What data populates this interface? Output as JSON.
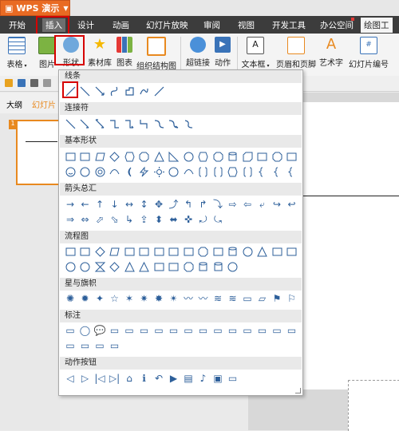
{
  "app": {
    "title": "WPS 演示"
  },
  "menu": {
    "tabs": [
      {
        "label": "开始"
      },
      {
        "label": "插入"
      },
      {
        "label": "设计"
      },
      {
        "label": "动画"
      },
      {
        "label": "幻灯片放映"
      },
      {
        "label": "审阅"
      },
      {
        "label": "视图"
      },
      {
        "label": "开发工具"
      },
      {
        "label": "办公空间"
      },
      {
        "label": "绘图工"
      }
    ],
    "active": "插入"
  },
  "ribbon": {
    "buttons": [
      {
        "label": "表格",
        "icon": "table-icon"
      },
      {
        "label": "图片",
        "icon": "picture-icon"
      },
      {
        "label": "形状",
        "icon": "shapes-icon"
      },
      {
        "label": "素材库",
        "icon": "star-icon"
      },
      {
        "label": "图表",
        "icon": "chart-icon"
      },
      {
        "label": "组织结构图",
        "icon": "org-chart-icon"
      },
      {
        "label": "超链接",
        "icon": "hyperlink-icon"
      },
      {
        "label": "动作",
        "icon": "action-icon"
      },
      {
        "label": "文本框",
        "icon": "textbox-icon"
      },
      {
        "label": "页眉和页脚",
        "icon": "header-footer-icon"
      },
      {
        "label": "艺术字",
        "icon": "wordart-icon"
      },
      {
        "label": "幻灯片编号",
        "icon": "slide-number-icon"
      }
    ]
  },
  "outline": {
    "tab_outline": "大纲",
    "tab_slides": "幻灯片",
    "slide_number": "1"
  },
  "shapes_menu": {
    "sections": [
      {
        "title": "线条",
        "count": 7
      },
      {
        "title": "连接符",
        "count": 9
      },
      {
        "title": "基本形状",
        "count": 32
      },
      {
        "title": "箭头总汇",
        "count": 27
      },
      {
        "title": "流程图",
        "count": 28
      },
      {
        "title": "星与旗帜",
        "count": 16
      },
      {
        "title": "标注",
        "count": 20
      },
      {
        "title": "动作按钮",
        "count": 12
      }
    ]
  },
  "colors": {
    "accent": "#e96b23",
    "highlight": "#d60000",
    "menubar": "#3c3c3c",
    "shape_stroke": "#2d5f9a",
    "shape_fill": "#ffffff"
  }
}
